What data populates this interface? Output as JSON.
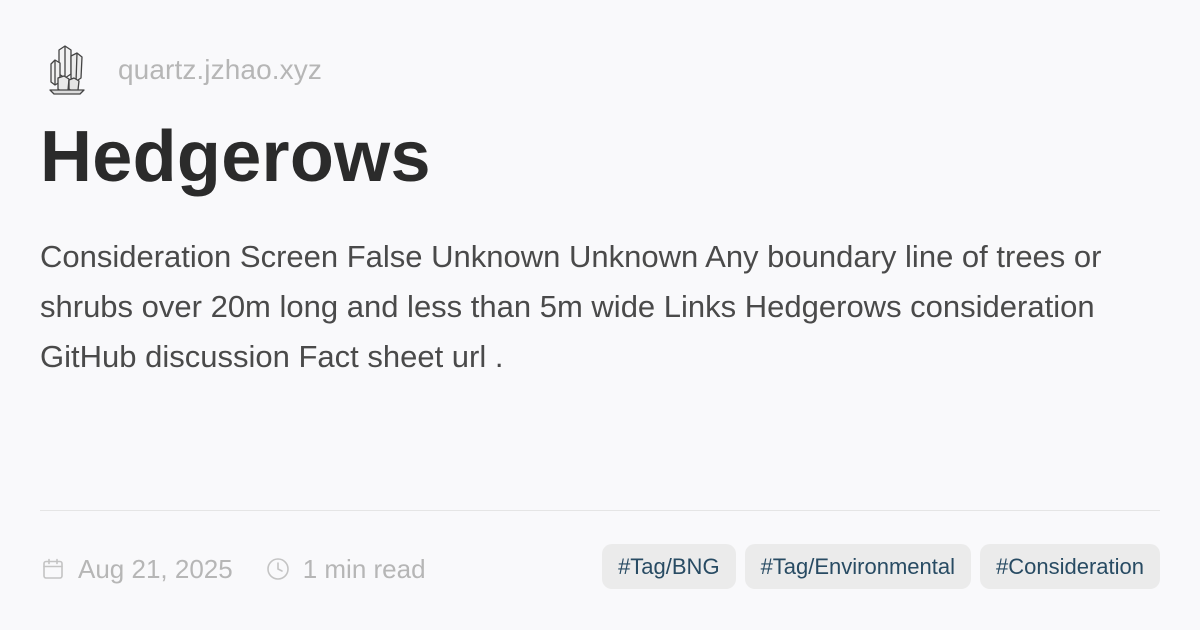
{
  "header": {
    "logo_icon": "crystal-cluster-icon",
    "site_url": "quartz.jzhao.xyz"
  },
  "page": {
    "title": "Hedgerows",
    "description": "Consideration Screen False Unknown Unknown Any boundary line of trees or shrubs over 20m long and less than 5m wide Links Hedgerows consideration GitHub discussion Fact sheet url ."
  },
  "meta": {
    "date_icon": "calendar-icon",
    "date": "Aug 21, 2025",
    "read_time_icon": "clock-icon",
    "read_time": "1 min read"
  },
  "tags": [
    {
      "label": "#Tag/BNG"
    },
    {
      "label": "#Tag/Environmental"
    },
    {
      "label": "#Consideration"
    }
  ],
  "colors": {
    "background": "#f9f9fb",
    "title": "#2b2b2b",
    "body_text": "#4a4a4a",
    "muted_text": "#b6b6b6",
    "tag_background": "#ebebeb",
    "tag_text": "#284b63"
  }
}
